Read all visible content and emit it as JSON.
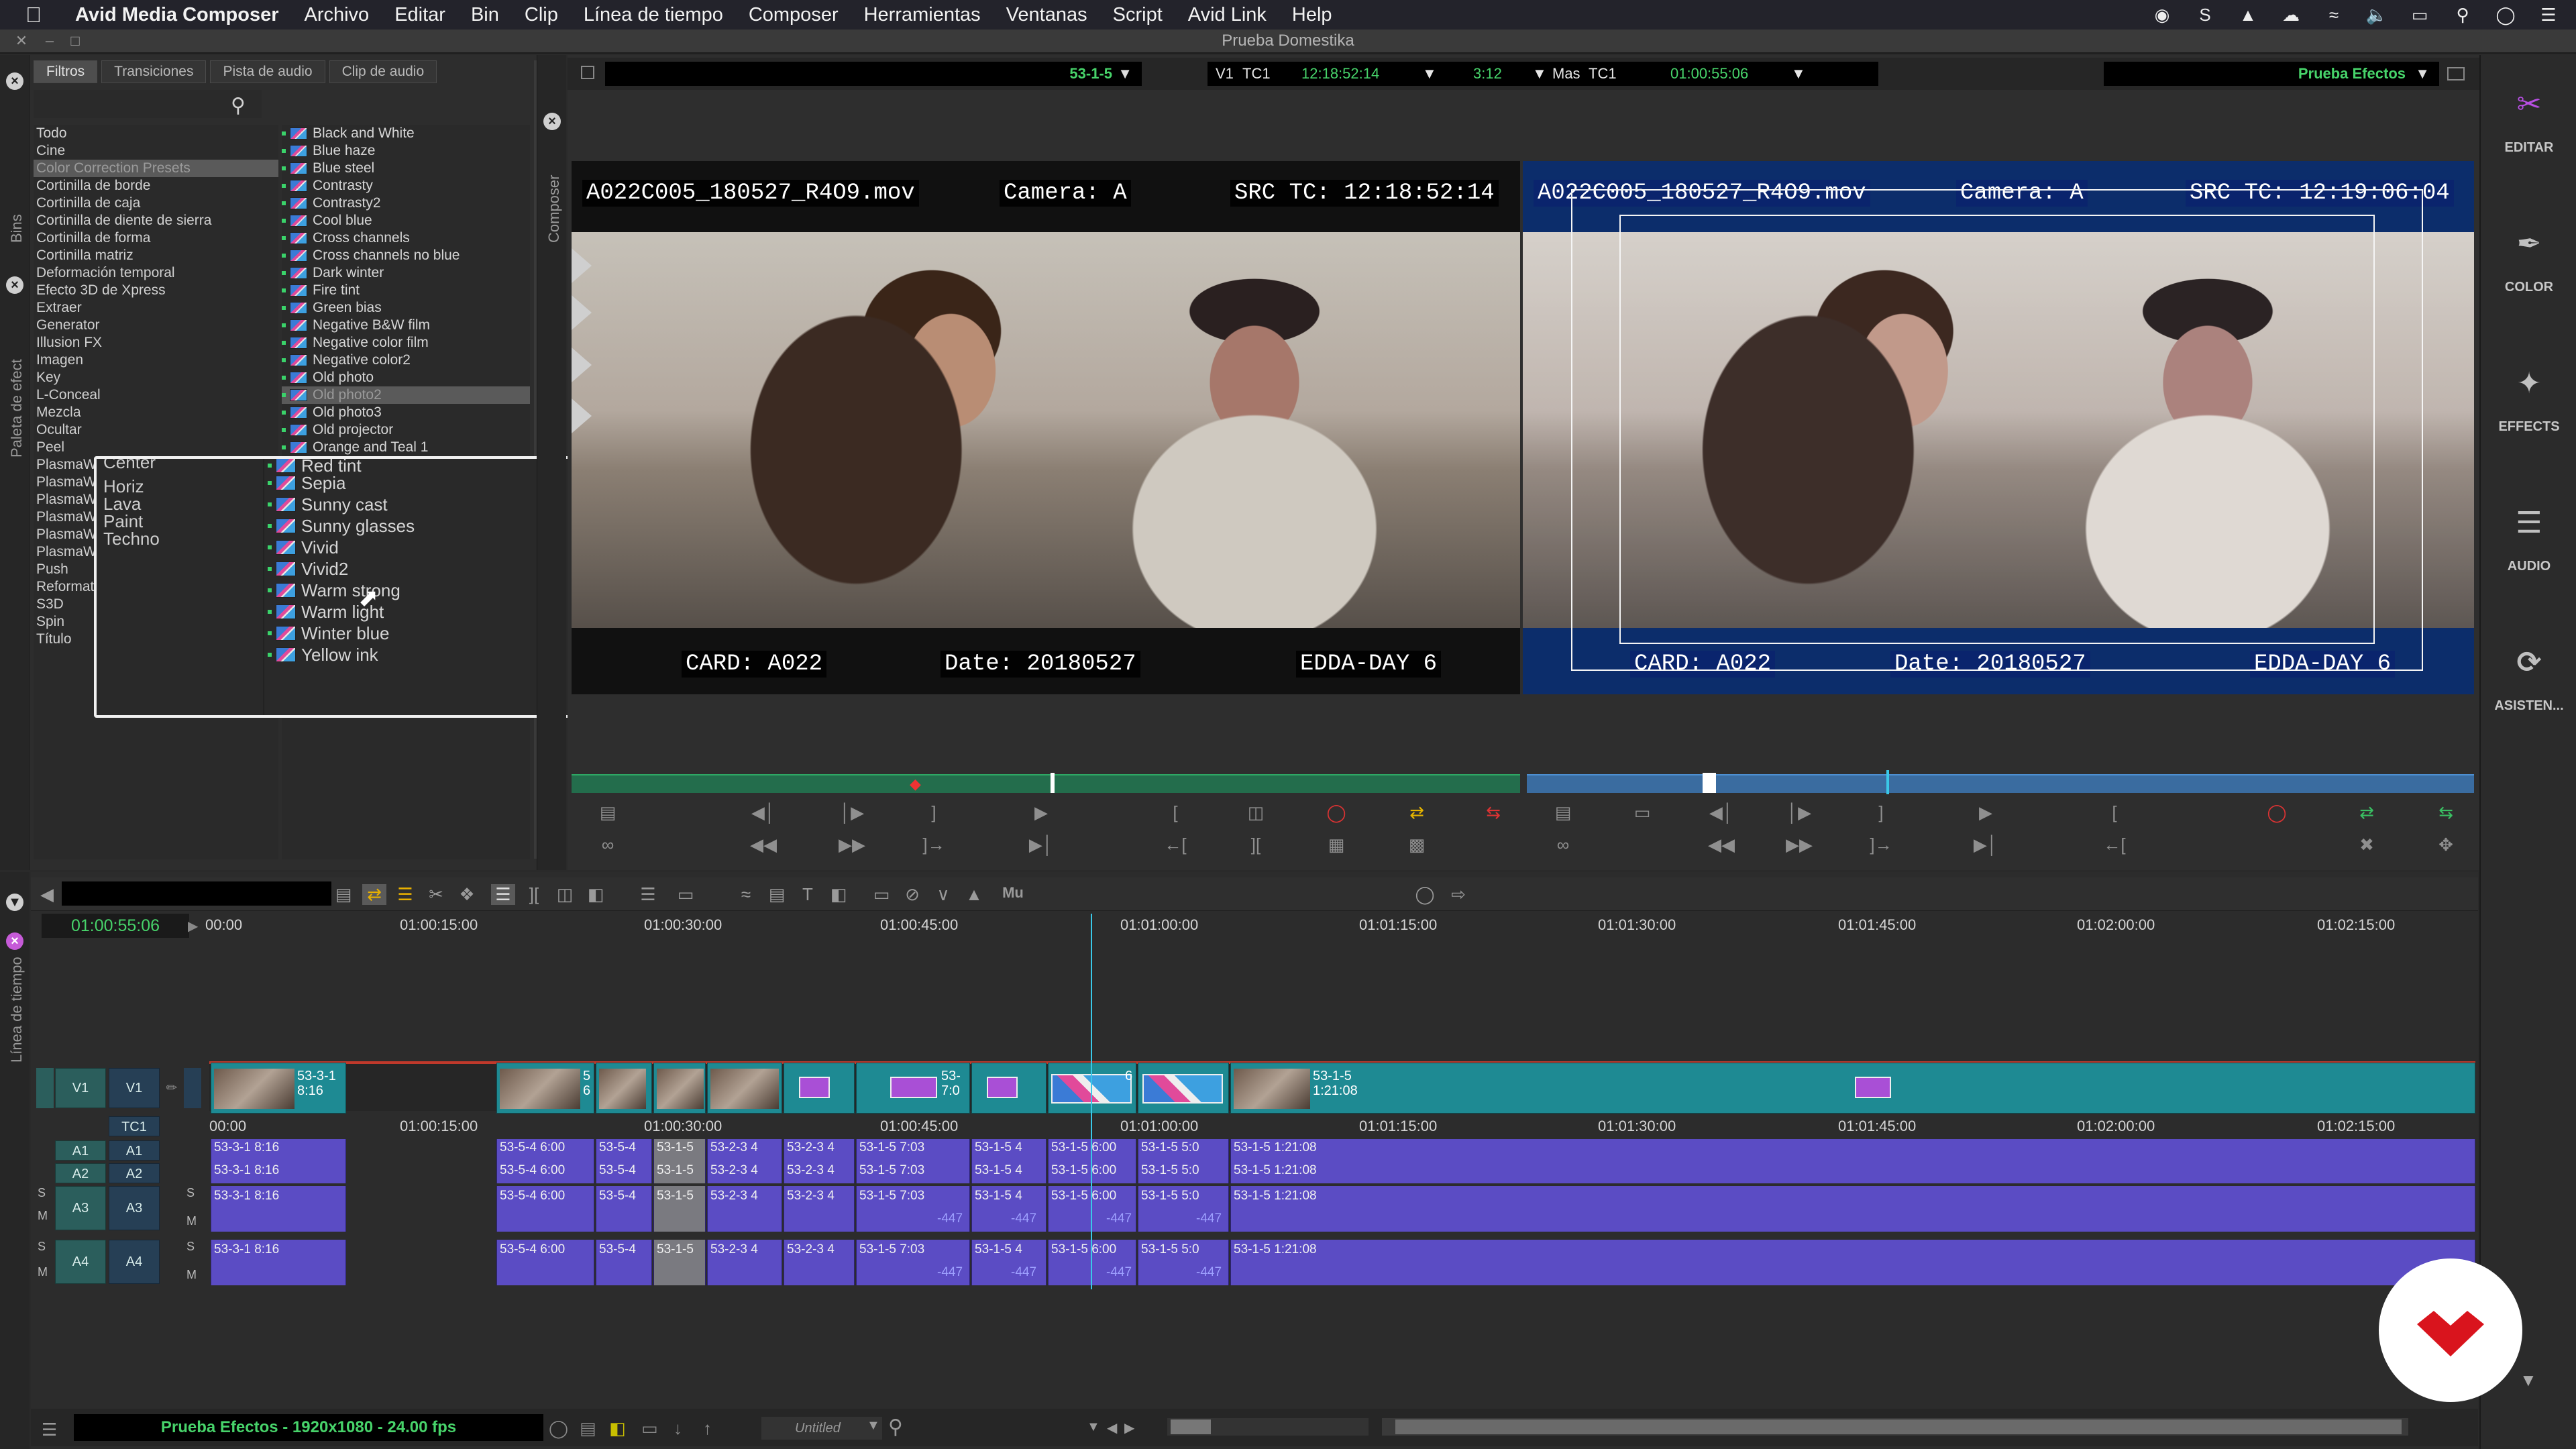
{
  "menubar": {
    "app_name": "Avid Media Composer",
    "items": [
      "Archivo",
      "Editar",
      "Bin",
      "Clip",
      "Línea de tiempo",
      "Composer",
      "Herramientas",
      "Ventanas",
      "Script",
      "Avid Link",
      "Help"
    ]
  },
  "window": {
    "title": "Prueba Domestika"
  },
  "effect_palette": {
    "tabs": [
      "Filtros",
      "Transiciones",
      "Pista de audio",
      "Clip de audio"
    ],
    "side_labels": {
      "bins": "Bins",
      "palette": "Paleta de efect"
    },
    "categories": [
      "Todo",
      "Cine",
      "Color Correction Presets",
      "Cortinilla de borde",
      "Cortinilla de caja",
      "Cortinilla de diente de sierra",
      "Cortinilla de forma",
      "Cortinilla matriz",
      "Deformación temporal",
      "Efecto 3D de Xpress",
      "Extraer",
      "Generator",
      "Illusion FX",
      "Imagen",
      "Key",
      "L-Conceal",
      "Mezcla",
      "Ocultar",
      "Peel",
      "PlasmaWave Center",
      "PlasmaWave Horiz",
      "PlasmaWave Lava",
      "PlasmaWave Paint",
      "PlasmaWave Techno",
      "PlasmaWave",
      "Push",
      "Reformat",
      "S3D",
      "Spin",
      "Título"
    ],
    "selected_category": "Color Correction Presets",
    "effects": [
      "Black and White",
      "Blue haze",
      "Blue steel",
      "Contrasty",
      "Contrasty2",
      "Cool blue",
      "Cross channels",
      "Cross channels no blue",
      "Dark winter",
      "Fire tint",
      "Green bias",
      "Negative B&W film",
      "Negative color film",
      "Negative color2",
      "Old photo",
      "Old photo2",
      "Old photo3",
      "Old projector",
      "Orange and Teal 1"
    ],
    "selected_effect": "Old photo2",
    "zoom_categories": [
      "Center",
      "Horiz",
      "Lava",
      "Paint",
      "Techno"
    ],
    "zoom_effects": [
      "Red tint",
      "Sepia",
      "Sunny cast",
      "Sunny glasses",
      "Vivid",
      "Vivid2",
      "Warm strong",
      "Warm light",
      "Winter blue",
      "Yellow ink"
    ]
  },
  "composer": {
    "side_label": "Composer",
    "source_clip": "53-1-5",
    "track_1": "V1",
    "tc_1": "TC1",
    "timecode_1": "12:18:52:14",
    "duration": "3:12",
    "mas_label": "Mas",
    "tc_2": "TC1",
    "timecode_2": "01:00:55:06",
    "record_sequence": "Prueba Efectos",
    "left_viewer": {
      "file": "A022C005_180527_R4O9.mov",
      "camera": "Camera: A",
      "src_tc": "SRC TC: 12:18:52:14",
      "card": "CARD: A022",
      "date": "Date: 20180527",
      "day": "EDDA-DAY 6"
    },
    "right_viewer": {
      "file": "A022C005_180527_R4O9.mov",
      "camera": "Camera: A",
      "src_tc": "SRC TC: 12:19:06:04",
      "card": "CARD: A022",
      "date": "Date: 20180527",
      "day": "EDDA-DAY 6"
    }
  },
  "workspaces": [
    {
      "label": "EDITAR",
      "icon": "edit-workspace-icon"
    },
    {
      "label": "COLOR",
      "icon": "color-workspace-icon"
    },
    {
      "label": "EFFECTS",
      "icon": "effects-workspace-icon"
    },
    {
      "label": "AUDIO",
      "icon": "audio-workspace-icon"
    },
    {
      "label": "ASISTEN...",
      "icon": "assistant-workspace-icon"
    }
  ],
  "timeline": {
    "side_label": "Línea de tiempo",
    "position_tc": "01:00:55:06",
    "mute_label": "Mu",
    "ruler": [
      "00:00",
      "01:00:15:00",
      "01:00:30:00",
      "01:00:45:00",
      "01:01:00:00",
      "01:01:15:00",
      "01:01:30:00",
      "01:01:45:00",
      "01:02:00:00",
      "01:02:15:00"
    ],
    "tracks": {
      "v1": "V1",
      "tc1": "TC1",
      "a1": "A1",
      "a2": "A2",
      "a3": "A3",
      "a4": "A4",
      "solo": "S",
      "mute": "M"
    },
    "video_clips": [
      {
        "label": "53-3-1\n8:16"
      },
      {
        "label": "5\n6"
      },
      {
        "label": "53-\n7:0"
      },
      {
        "label": "6"
      },
      {
        "label": "53-1-5\n1:21:08"
      }
    ],
    "audio_labels": {
      "a1": [
        "53-3-1 8:16",
        "53-5-4 6:00",
        "53-5-4",
        "53-1-5",
        "53-2-3 4",
        "53-2-3 4",
        "53-1-5 7:03",
        "53-1-5 4",
        "53-1-5 6:00",
        "53-1-5 5:0",
        "53-1-5 1:21:08"
      ],
      "a3": [
        "53-3-1 8:16",
        "53-5-4 6:00",
        "53-5-4",
        "53-1-5",
        "53-2-3 4",
        "53-2-3 4",
        "53-1-5 7:03",
        "53-1-5 4",
        "53-1-5 6:00",
        "53-1-5 5:0",
        "53-1-5 1:21:08"
      ],
      "level": "-447"
    },
    "sequence_info": "Prueba Efectos - 1920x1080 - 24.00 fps",
    "bin_dropdown": "Untitled"
  },
  "colors": {
    "video_clip": "#1e8a93",
    "audio_clip": "#5b4cc4",
    "timecode_green": "#47d36a",
    "playhead": "#3ac8e8",
    "workspace_active": "#b84ee3"
  }
}
